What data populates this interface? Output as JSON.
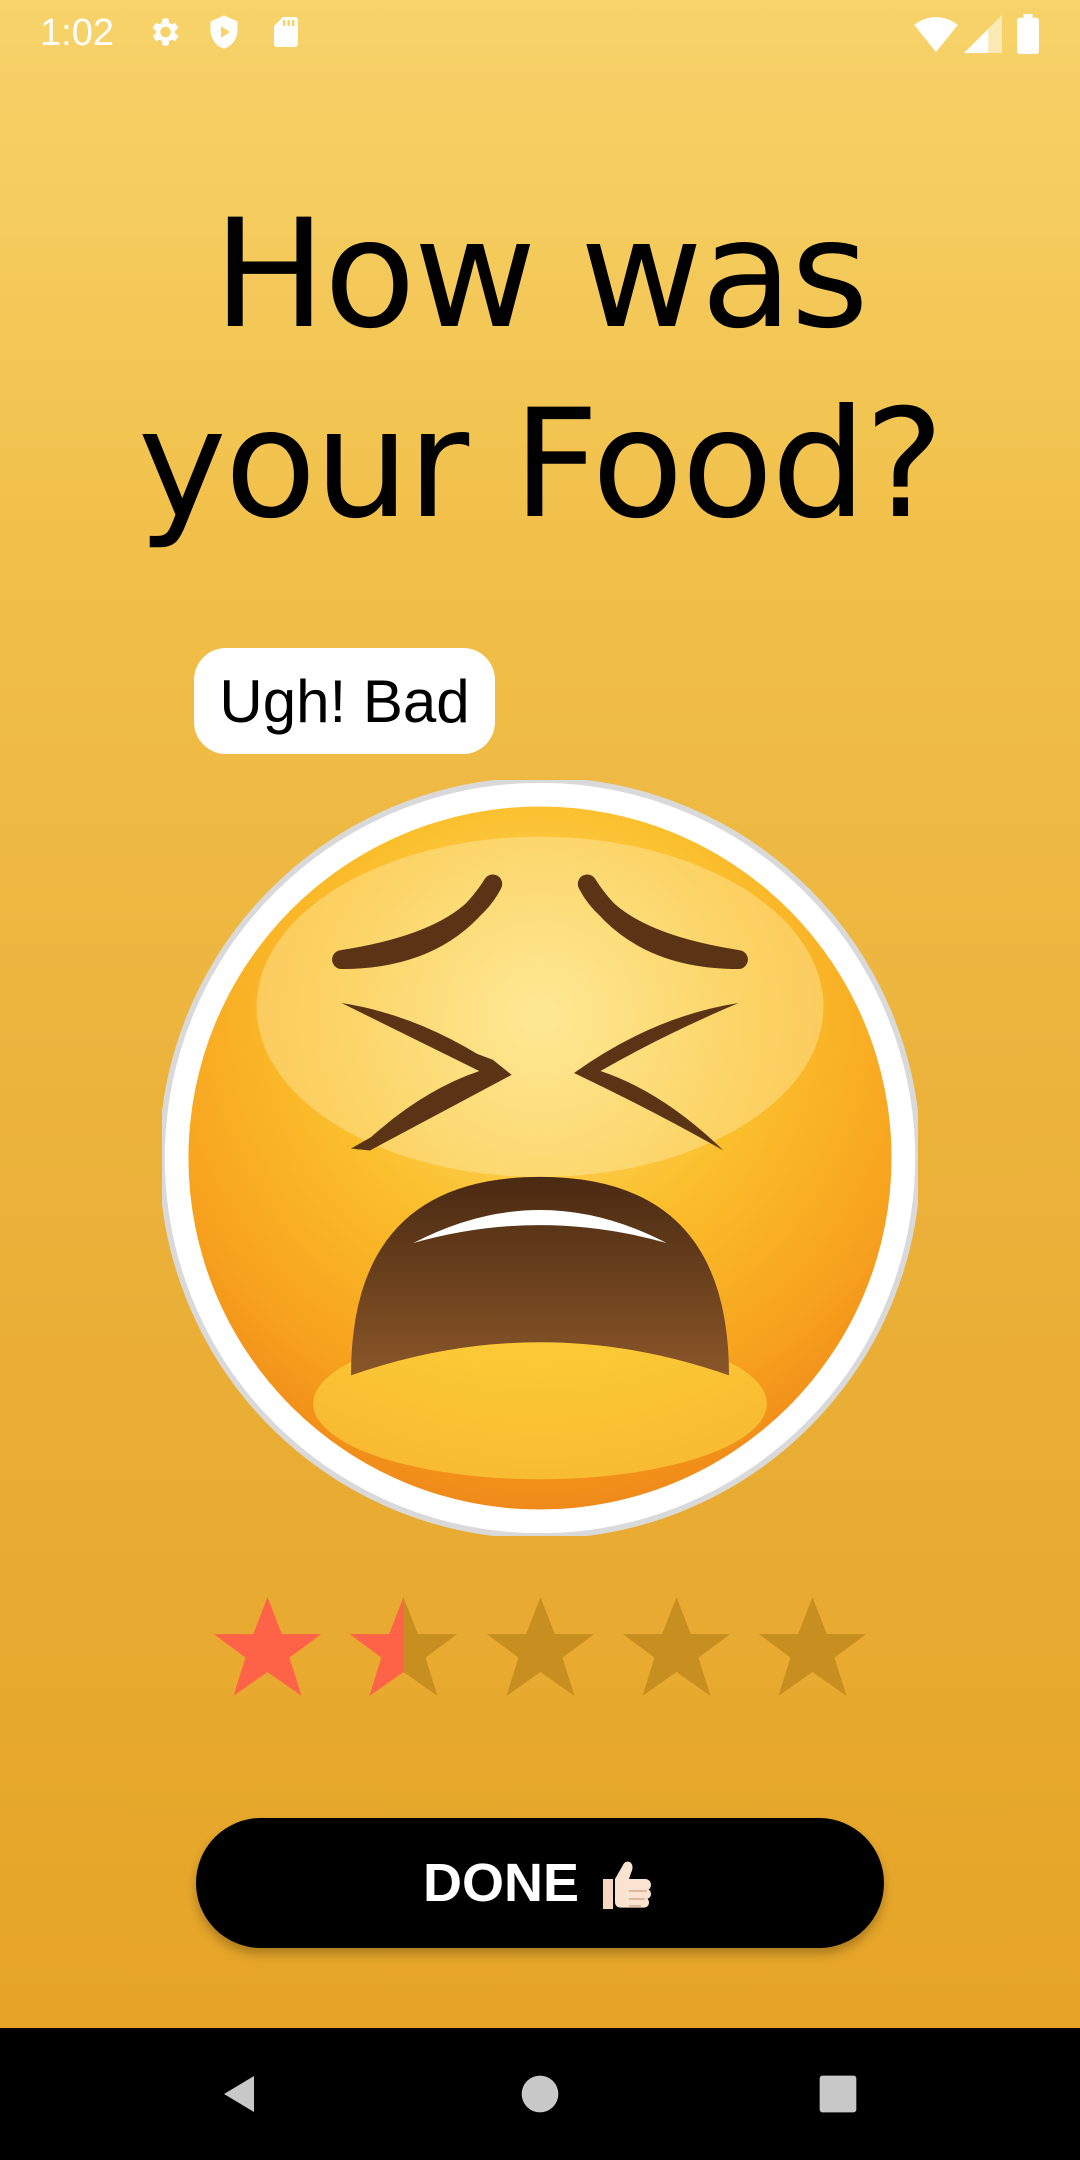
{
  "status_bar": {
    "time": "1:02",
    "icons": [
      "settings-icon",
      "shield-icon",
      "sd-card-icon",
      "wifi-icon",
      "signal-icon",
      "battery-icon"
    ]
  },
  "title": {
    "line1": "How was",
    "line2": "your Food?"
  },
  "mood_label": "Ugh! Bad",
  "emoji": "tired-face-emoji",
  "rating": {
    "value": 1.5,
    "max": 5,
    "filled_color": "#ff6347",
    "empty_color": "#c78f1f"
  },
  "done_button": {
    "label": "DONE",
    "icon": "thumbs-up-icon"
  },
  "nav_bar": {
    "buttons": [
      "back-icon",
      "home-icon",
      "recents-icon"
    ]
  },
  "colors": {
    "background_top": "#f7d36a",
    "background_bottom": "#e4a224",
    "button": "#000000"
  }
}
